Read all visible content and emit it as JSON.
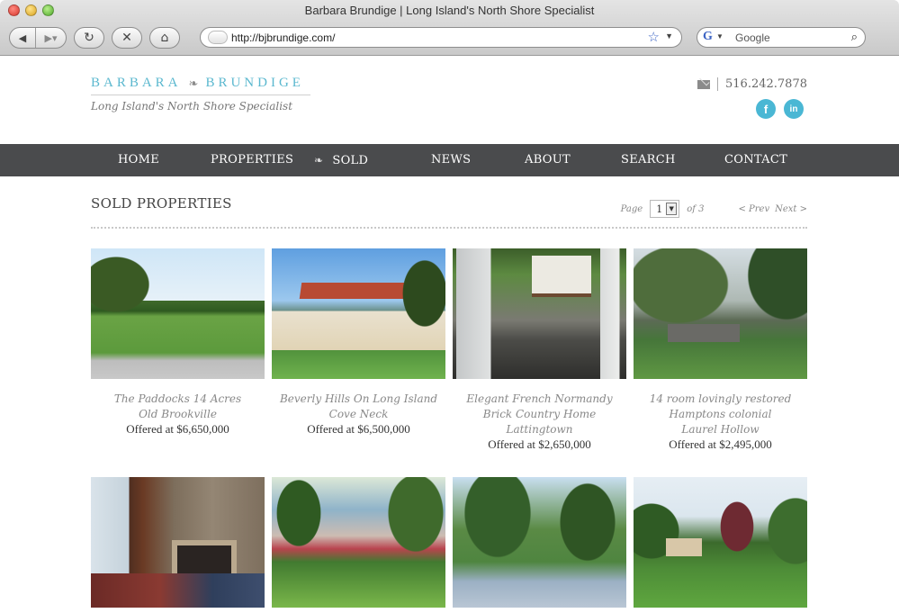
{
  "browser": {
    "window_title": "Barbara Brundige | Long Island's North Shore Specialist",
    "url": "http://bjbrundige.com/",
    "search_placeholder": "Google",
    "search_logo": "G"
  },
  "site": {
    "logo_first": "BARBARA",
    "logo_last": "BRUNDIGE",
    "logo_mark": "❧",
    "tagline": "Long Island's North Shore Specialist",
    "phone": "516.242.7878",
    "social": [
      "f",
      "in"
    ]
  },
  "nav": {
    "items": [
      "HOME",
      "PROPERTIES",
      "SOLD",
      "NEWS",
      "ABOUT",
      "SEARCH",
      "CONTACT"
    ],
    "sold_icon": "❧"
  },
  "section": {
    "title": "SOLD PROPERTIES",
    "page_label": "Page",
    "page_current": "1",
    "page_of": "of 3",
    "prev": "< Prev",
    "next": "Next >"
  },
  "properties": [
    {
      "line1": "The Paddocks 14 Acres",
      "line2": "Old Brookville",
      "line3": "",
      "price": "Offered at $6,650,000"
    },
    {
      "line1": "Beverly Hills On Long Island",
      "line2": "Cove Neck",
      "line3": "",
      "price": "Offered at $6,500,000"
    },
    {
      "line1": "Elegant French Normandy",
      "line2": "Brick Country Home",
      "line3": "Lattingtown",
      "price": "Offered at $2,650,000"
    },
    {
      "line1": "14 room lovingly restored",
      "line2": "Hamptons colonial",
      "line3": "Laurel Hollow",
      "price": "Offered at $2,495,000"
    }
  ],
  "colors": {
    "accent": "#4ab7d4",
    "nav_bg": "#4a4b4d",
    "logo_text": "#5bb8cf"
  }
}
